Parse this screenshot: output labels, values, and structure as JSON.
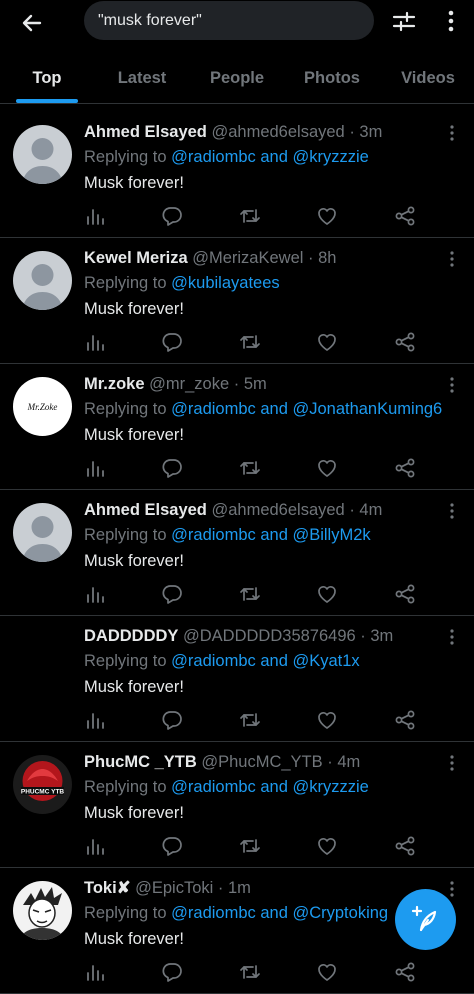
{
  "search": {
    "query": "\"musk forever\""
  },
  "tabs": [
    {
      "label": "Top",
      "active": true
    },
    {
      "label": "Latest",
      "active": false
    },
    {
      "label": "People",
      "active": false
    },
    {
      "label": "Photos",
      "active": false
    },
    {
      "label": "Videos",
      "active": false
    }
  ],
  "colors": {
    "accent": "#1d9bf0",
    "background": "#000000",
    "muted": "#71767b",
    "text": "#e7e9ea"
  },
  "tweets": [
    {
      "name": "Ahmed Elsayed",
      "handle": "@ahmed6elsayed",
      "time": "· 3m",
      "reply_prefix": "Replying to",
      "reply_to": "@radiombc and @kryzzzie",
      "text": "Musk forever!",
      "avatar": "default-avatar-icon"
    },
    {
      "name": "Kewel Meriza",
      "handle": "@MerizaKewel",
      "time": "· 8h",
      "reply_prefix": "Replying to",
      "reply_to": "@kubilayatees",
      "text": "Musk forever!",
      "avatar": "default-avatar-icon"
    },
    {
      "name": "Mr.zoke",
      "handle": "@mr_zoke",
      "time": "· 5m",
      "reply_prefix": "Replying to",
      "reply_to": "@radiombc and @JonathanKuming6",
      "text": "Musk forever!",
      "avatar": "mrzoke-logo-avatar",
      "avatar_text": "Mr.Zoke"
    },
    {
      "name": "Ahmed Elsayed",
      "handle": "@ahmed6elsayed",
      "time": "· 4m",
      "reply_prefix": "Replying to",
      "reply_to": "@radiombc and @BillyM2k",
      "text": "Musk forever!",
      "avatar": "default-avatar-icon"
    },
    {
      "name": "DADDDDDY",
      "handle": "@DADDDDD35876496",
      "time": "· 3m",
      "reply_prefix": "Replying to",
      "reply_to": "@radiombc and @Kyat1x",
      "text": "Musk forever!",
      "avatar": "none"
    },
    {
      "name": "PhucMC _YTB",
      "handle": "@PhucMC_YTB",
      "time": "· 4m",
      "reply_prefix": "Replying to",
      "reply_to": "@radiombc and @kryzzzie",
      "text": "Musk forever!",
      "avatar": "red-emblem-avatar",
      "avatar_text": "PHUCMC YTB"
    },
    {
      "name": "Toki✘",
      "handle": "@EpicToki",
      "time": "· 1m",
      "reply_prefix": "Replying to",
      "reply_to": "@radiombc and @Cryptoking",
      "text": "Musk forever!",
      "avatar": "anime-avatar"
    }
  ]
}
